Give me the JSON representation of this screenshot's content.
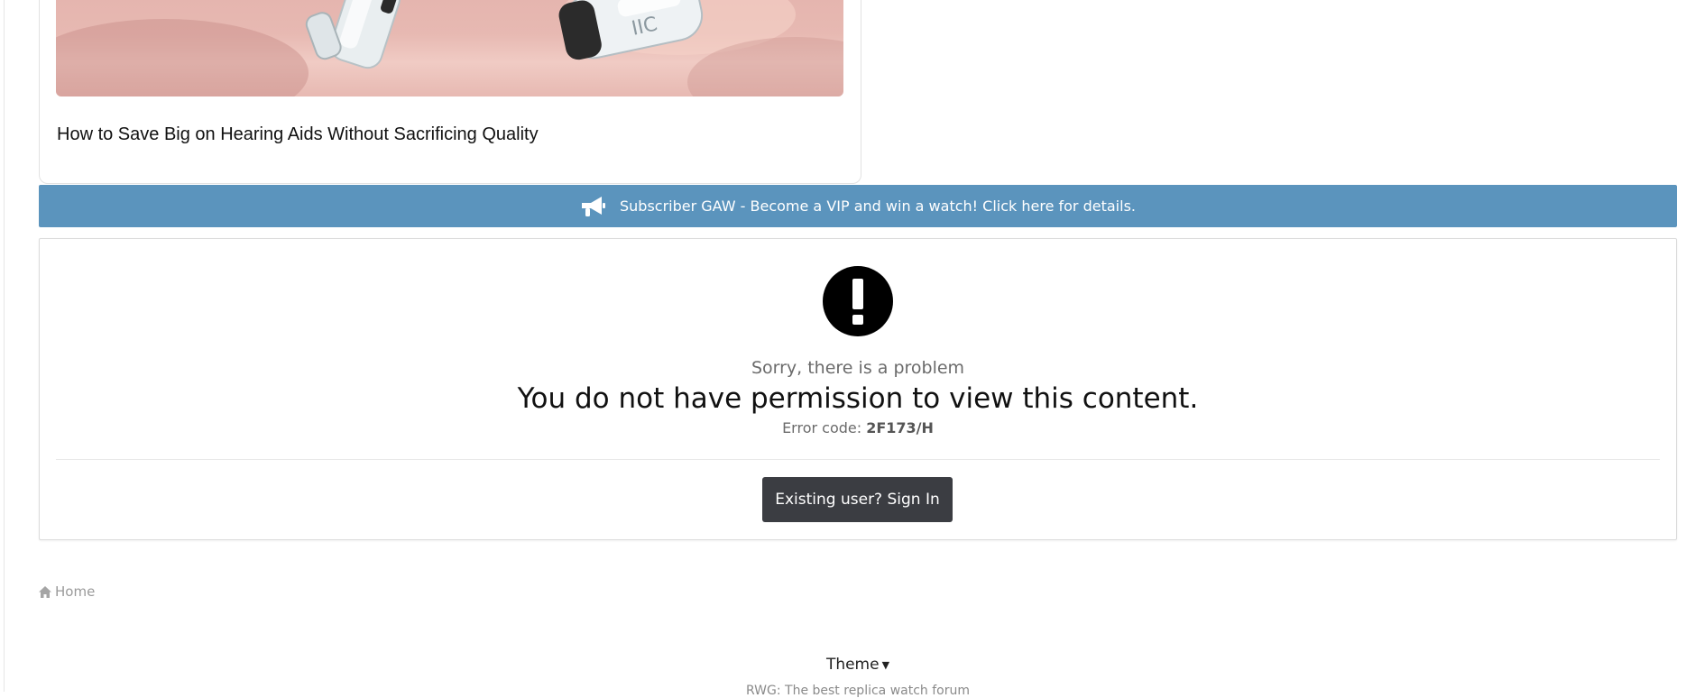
{
  "ad": {
    "title": "How to Save Big on Hearing Aids Without Sacrificing Quality",
    "image_label": "IIC"
  },
  "announcement": {
    "icon": "megaphone-icon",
    "text": "Subscriber GAW - Become a VIP and win a watch! Click here for details."
  },
  "error": {
    "icon": "exclamation-circle-icon",
    "subtitle": "Sorry, there is a problem",
    "message": "You do not have permission to view this content.",
    "code_label": "Error code:",
    "code_value": "2F173/H",
    "signin_button": "Existing user? Sign In"
  },
  "breadcrumb": {
    "icon": "home-icon",
    "home_label": "Home"
  },
  "footer": {
    "theme_label": "Theme",
    "tagline": "RWG: The best replica watch forum"
  },
  "colors": {
    "announcement_bg": "#5b94bd",
    "button_bg": "#3b3d42"
  }
}
